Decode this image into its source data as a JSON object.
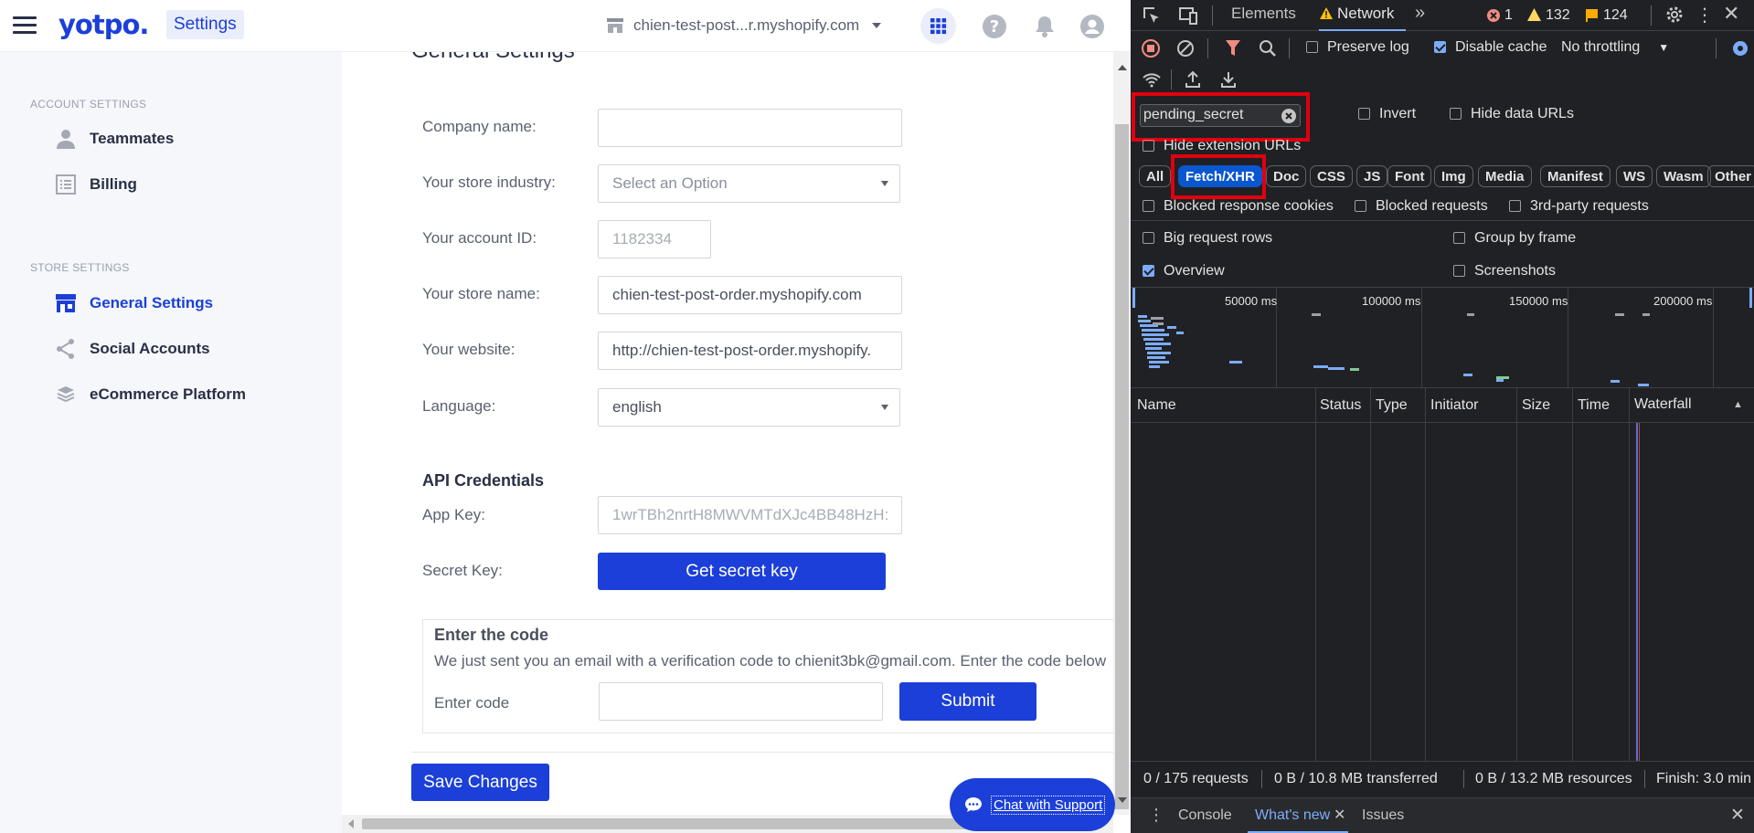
{
  "app": {
    "logo": "yotpo.",
    "section_chip": "Settings",
    "store_selector": "chien-test-post...r.myshopify.com"
  },
  "sidebar": {
    "account_heading": "ACCOUNT SETTINGS",
    "store_heading": "STORE SETTINGS",
    "items": [
      {
        "label": "Teammates",
        "icon": "person-icon"
      },
      {
        "label": "Billing",
        "icon": "list-icon"
      },
      {
        "label": "General Settings",
        "icon": "storefront-icon",
        "active": true
      },
      {
        "label": "Social Accounts",
        "icon": "share-icon"
      },
      {
        "label": "eCommerce Platform",
        "icon": "layers-icon"
      }
    ]
  },
  "main": {
    "heading": "General Settings",
    "company_label": "Company name:",
    "company_value": "",
    "industry_label": "Your store industry:",
    "industry_placeholder": "Select an Option",
    "account_label": "Your account ID:",
    "account_value": "1182334",
    "storename_label": "Your store name:",
    "storename_value": "chien-test-post-order.myshopify.com",
    "website_label": "Your website:",
    "website_value": "http://chien-test-post-order.myshopify.",
    "language_label": "Language:",
    "language_value": "english",
    "api_heading": "API Credentials",
    "appkey_label": "App Key:",
    "appkey_value": "1wrTBh2nrtH8MWVMTdXJc4BB48HzH:",
    "secret_label": "Secret Key:",
    "secret_button": "Get secret key",
    "code_heading": "Enter the code",
    "code_text": "We just sent you an email with a verification code to chienit3bk@gmail.com. Enter the code below",
    "code_label": "Enter code",
    "submit_button": "Submit",
    "save_button": "Save Changes",
    "chat_button": "Chat with Support"
  },
  "devtools": {
    "tabs": [
      "Elements",
      "Network"
    ],
    "active_tab": "Network",
    "error_count": "1",
    "warning_count": "132",
    "issue_count": "124",
    "preserve_log": "Preserve log",
    "disable_cache": "Disable cache",
    "throttling": "No throttling",
    "filter_value": "pending_secret",
    "invert": "Invert",
    "hide_data_urls": "Hide data URLs",
    "hide_extension_urls": "Hide extension URLs",
    "filters": [
      "All",
      "Fetch/XHR",
      "Doc",
      "CSS",
      "JS",
      "Font",
      "Img",
      "Media",
      "Manifest",
      "WS",
      "Wasm",
      "Other"
    ],
    "active_filter": "Fetch/XHR",
    "blocked_cookies": "Blocked response cookies",
    "blocked_requests": "Blocked requests",
    "third_party": "3rd-party requests",
    "big_rows": "Big request rows",
    "group_by_frame": "Group by frame",
    "overview": "Overview",
    "screenshots": "Screenshots",
    "timeline_labels": [
      "50000 ms",
      "100000 ms",
      "150000 ms",
      "200000 ms"
    ],
    "columns": [
      "Name",
      "Status",
      "Type",
      "Initiator",
      "Size",
      "Time",
      "Waterfall"
    ],
    "status_requests": "0 / 175 requests",
    "status_transferred": "0 B / 10.8 MB transferred",
    "status_resources": "0 B / 13.2 MB resources",
    "status_finish": "Finish: 3.0 min",
    "drawer_tabs": [
      "Console",
      "What's new",
      "Issues"
    ],
    "active_drawer_tab": "What's new"
  },
  "colors": {
    "brand": "#1b3fd8",
    "devtools_bg": "#202124",
    "highlight": "#e0000f"
  }
}
